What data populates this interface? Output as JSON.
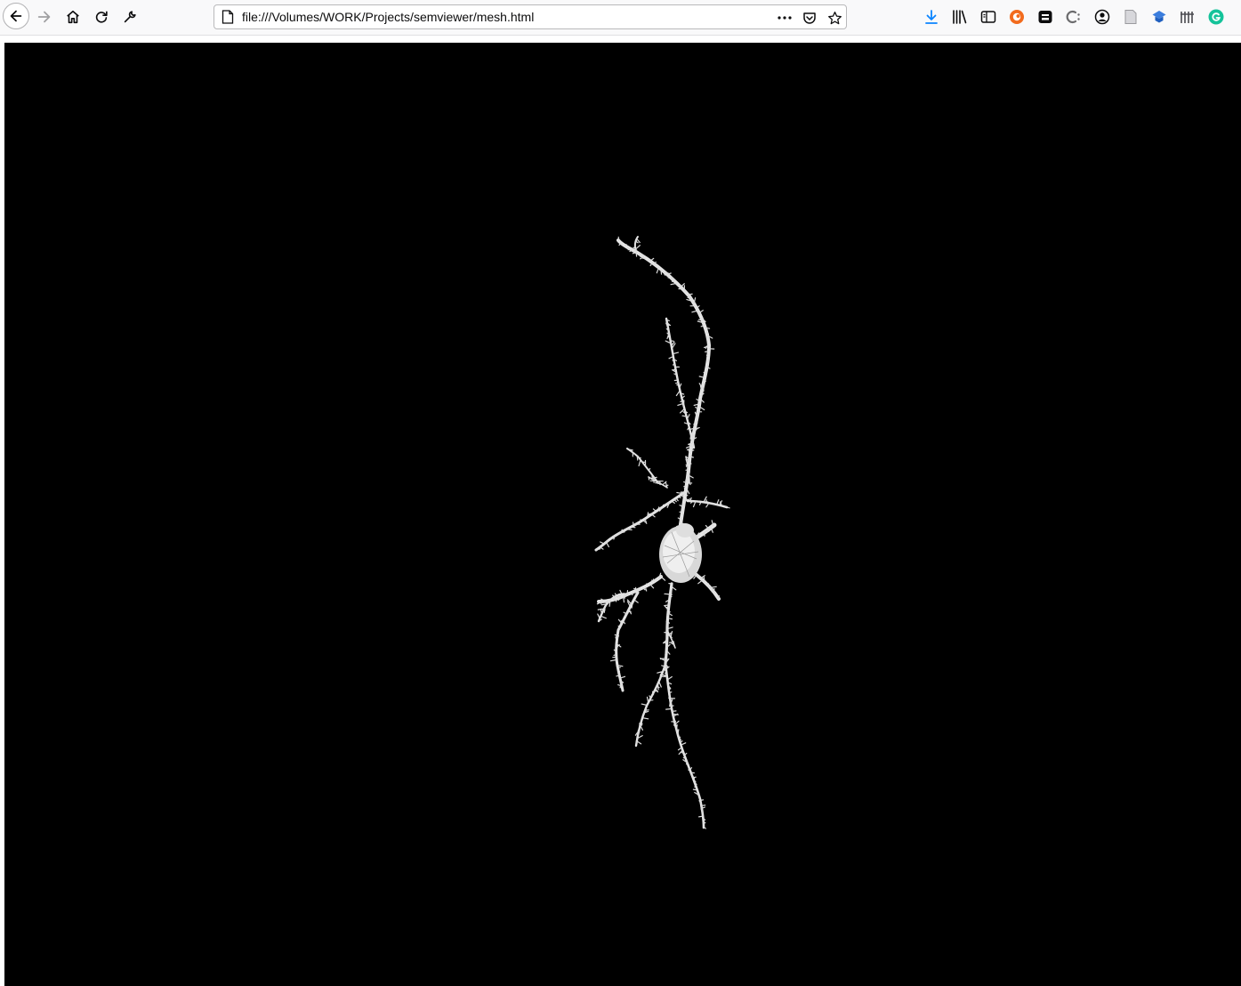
{
  "browser": {
    "url": "file:///Volumes/WORK/Projects/semviewer/mesh.html",
    "nav_icons": [
      "back-arrow-icon",
      "forward-arrow-icon",
      "home-icon",
      "reload-icon",
      "wrench-icon"
    ],
    "url_actions": [
      "more-actions-icon",
      "pocket-icon",
      "bookmark-star-icon"
    ],
    "extension_icons": [
      "download-icon",
      "library-icon",
      "sidebar-icon",
      "extension-orange-icon",
      "extension-dark-icon",
      "extension-c-icon",
      "account-icon",
      "reader-icon",
      "extension-blue-icon",
      "extension-bars-icon",
      "grammarly-icon"
    ]
  },
  "viewer": {
    "background": "#000000",
    "mesh_color": "#e8e8e8",
    "subject": "neuron-mesh"
  }
}
